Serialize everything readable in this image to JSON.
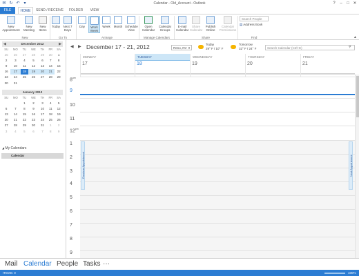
{
  "window": {
    "title": "Calendar - Old_Account - Outlook"
  },
  "tabs": [
    "FILE",
    "HOME",
    "SEND / RECEIVE",
    "FOLDER",
    "VIEW"
  ],
  "ribbon": {
    "new_appointment": "New Appointment",
    "new_meeting": "New Meeting",
    "new_items": "New Items",
    "group_new": "New",
    "today": "Today",
    "next7": "Next 7 Days",
    "group_goto": "Go To",
    "day": "Day",
    "work_week": "Work Week",
    "week": "Week",
    "month": "Month",
    "schedule_view": "Schedule View",
    "group_arrange": "Arrange",
    "open_calendar": "Open Calendar",
    "calendar_groups": "Calendar Groups",
    "group_manage": "Manage Calendars",
    "email_calendar": "E-mail Calendar",
    "share_calendar": "Share Calendar",
    "publish_online": "Publish Online",
    "calendar_permissions": "Calendar Permissions",
    "group_share": "Share",
    "search_people": "Search People",
    "address_book": "Address Book",
    "group_find": "Find"
  },
  "mini_cal_dec": {
    "title": "December 2012",
    "weekdays": [
      "SU",
      "MO",
      "TU",
      "WE",
      "TH",
      "FR",
      "SA"
    ],
    "weeks": [
      [
        "25",
        "26",
        "27",
        "28",
        "29",
        "30",
        "1"
      ],
      [
        "2",
        "3",
        "4",
        "5",
        "6",
        "7",
        "8"
      ],
      [
        "9",
        "10",
        "11",
        "12",
        "13",
        "14",
        "15"
      ],
      [
        "16",
        "17",
        "18",
        "19",
        "20",
        "21",
        "22"
      ],
      [
        "23",
        "24",
        "25",
        "26",
        "27",
        "28",
        "29"
      ],
      [
        "30",
        "31",
        "",
        "",
        "",
        "",
        ""
      ]
    ]
  },
  "mini_cal_jan": {
    "title": "January 2013",
    "weekdays": [
      "SU",
      "MO",
      "TU",
      "WE",
      "TH",
      "FR",
      "SA"
    ],
    "weeks": [
      [
        "",
        "",
        "1",
        "2",
        "3",
        "4",
        "5"
      ],
      [
        "6",
        "7",
        "8",
        "9",
        "10",
        "11",
        "12"
      ],
      [
        "13",
        "14",
        "15",
        "16",
        "17",
        "18",
        "19"
      ],
      [
        "20",
        "21",
        "22",
        "23",
        "24",
        "25",
        "26"
      ],
      [
        "27",
        "28",
        "29",
        "30",
        "31",
        "1",
        "2"
      ],
      [
        "3",
        "4",
        "5",
        "6",
        "7",
        "8",
        "9"
      ]
    ]
  },
  "folders": {
    "group": "My Calendars",
    "item": "Calendar"
  },
  "main": {
    "date_range": "December 17 - 21, 2012",
    "location": "Reno, NV",
    "weather_today_label": "Today",
    "weather_today_temp": "29° F / 10° F",
    "weather_tomorrow_label": "Tomorrow",
    "weather_tomorrow_temp": "32° F / 24° F",
    "search_placeholder": "Search Calendar (Ctrl+E)",
    "days": [
      {
        "name": "MONDAY",
        "num": "17"
      },
      {
        "name": "TUESDAY",
        "num": "18"
      },
      {
        "name": "WEDNESDAY",
        "num": "19"
      },
      {
        "name": "THURSDAY",
        "num": "20"
      },
      {
        "name": "FRIDAY",
        "num": "21"
      }
    ],
    "hours": [
      "8",
      "9",
      "10",
      "11",
      "12",
      "1",
      "2",
      "3",
      "4",
      "5",
      "6",
      "7",
      "8",
      "9"
    ],
    "hour_suffix_8": "am",
    "hour_suffix_12": "pm",
    "prev_appt": "Previous Appointment",
    "next_appt": "Next Appointment"
  },
  "bottom_nav": [
    "Mail",
    "Calendar",
    "People",
    "Tasks",
    "···"
  ],
  "status": {
    "items": "ITEMS: 0",
    "zoom": "100%"
  },
  "colors": {
    "accent": "#2b7cd3",
    "selected": "#cde6f7"
  }
}
